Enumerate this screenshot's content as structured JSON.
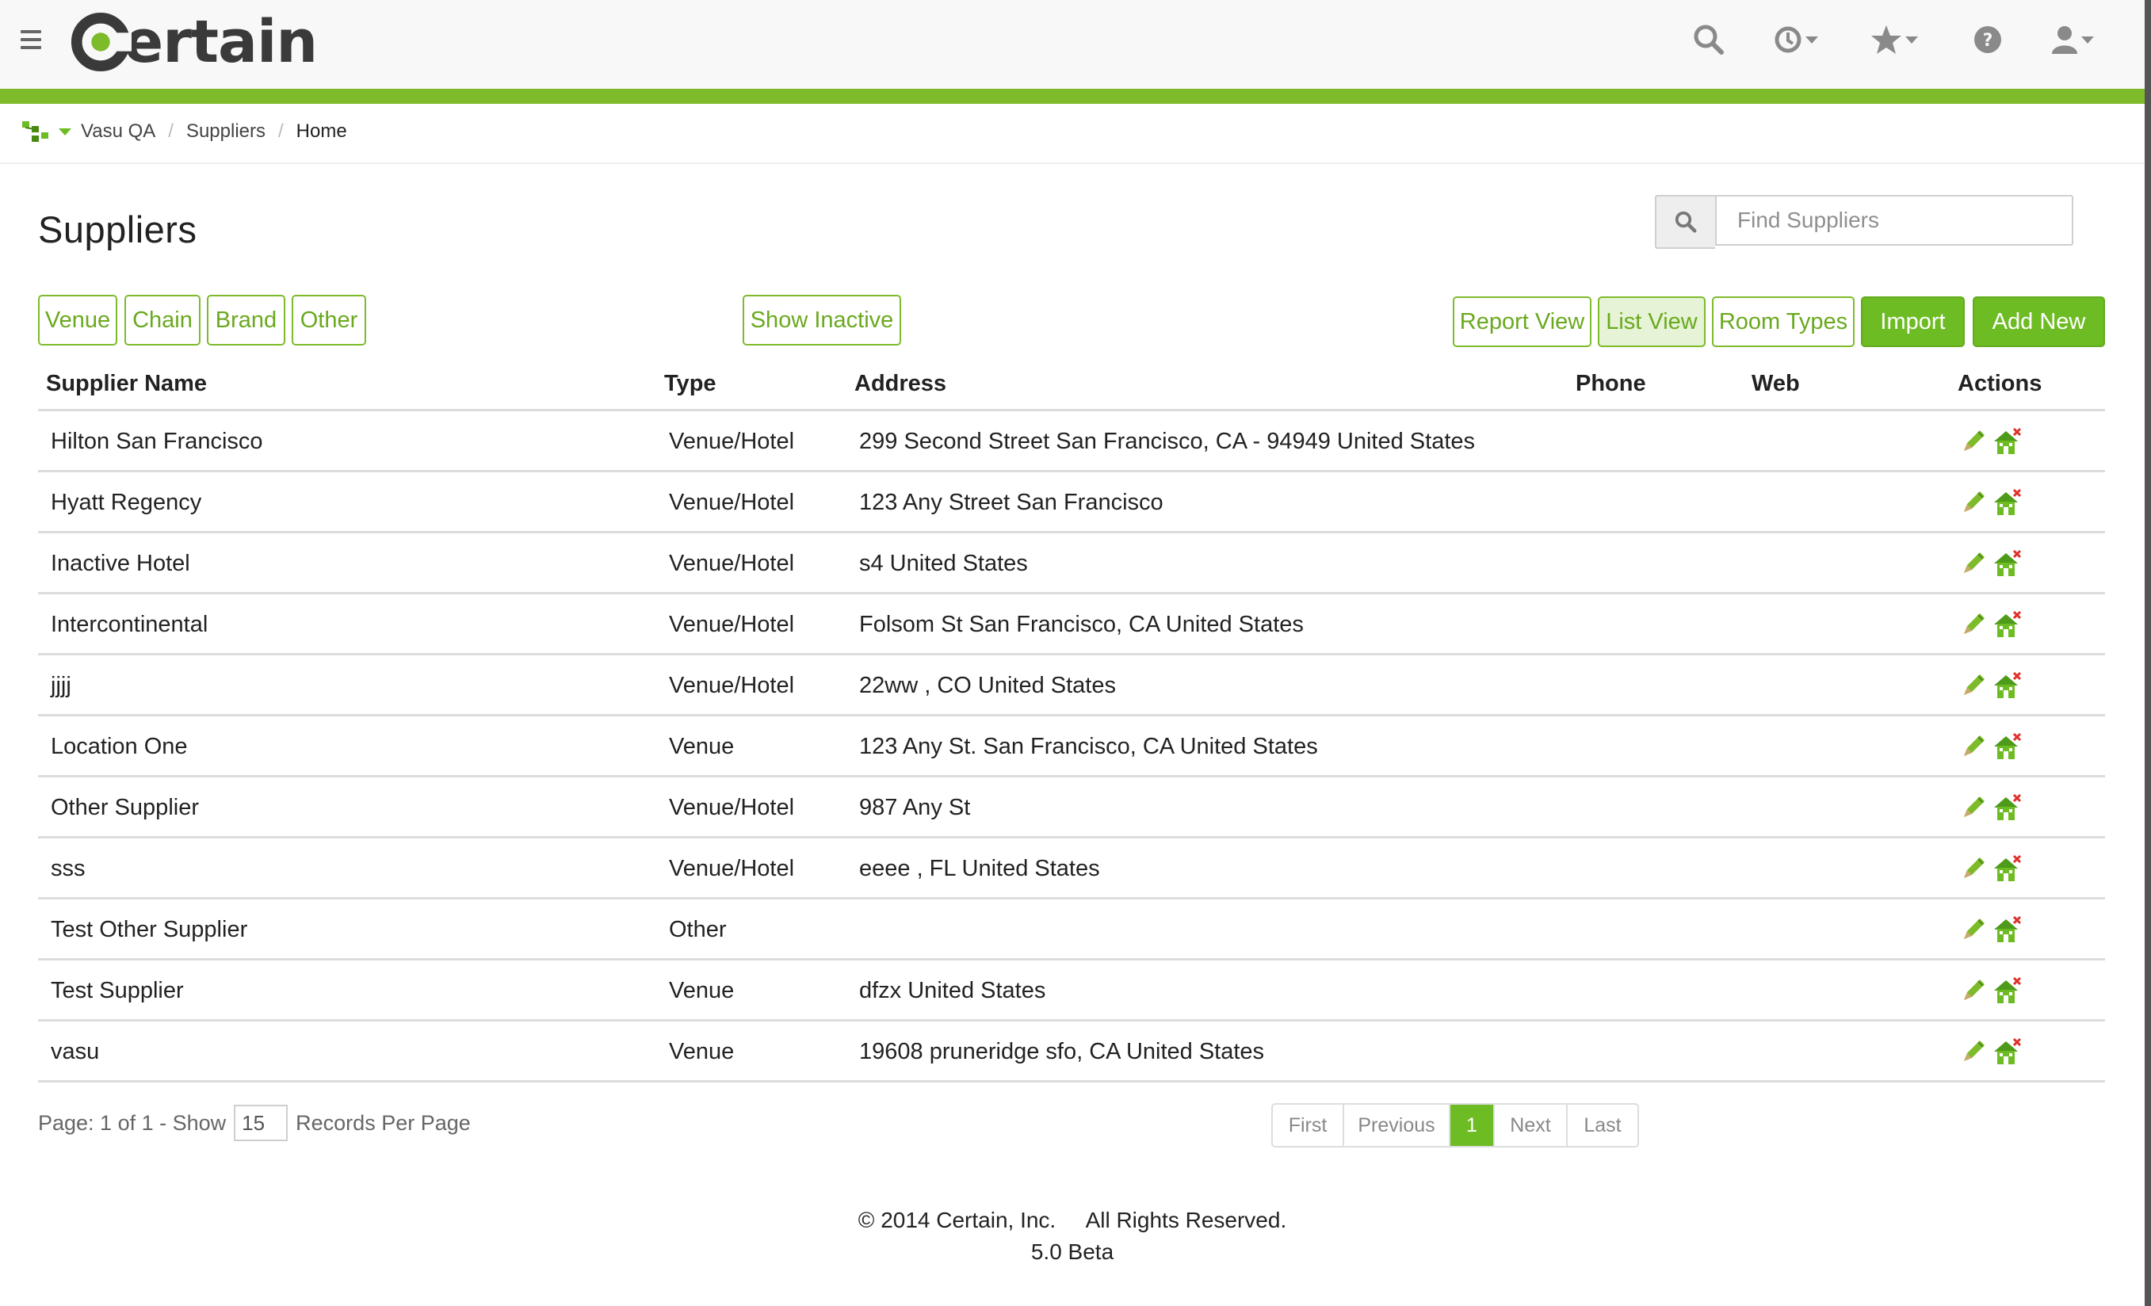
{
  "app": {
    "logo_text": "ertain"
  },
  "breadcrumb": {
    "items": [
      "Vasu QA",
      "Suppliers",
      "Home"
    ]
  },
  "page": {
    "title": "Suppliers"
  },
  "search": {
    "placeholder": "Find Suppliers",
    "value": ""
  },
  "filters": {
    "venue": "Venue",
    "chain": "Chain",
    "brand": "Brand",
    "other": "Other",
    "show_inactive": "Show Inactive"
  },
  "toolbar": {
    "report_view": "Report View",
    "list_view": "List View",
    "room_types": "Room Types",
    "import": "Import",
    "add_new": "Add New"
  },
  "table": {
    "headers": {
      "name": "Supplier Name",
      "type": "Type",
      "address": "Address",
      "phone": "Phone",
      "web": "Web",
      "actions": "Actions"
    },
    "rows": [
      {
        "name": "Hilton San Francisco",
        "type": "Venue/Hotel",
        "address": "299 Second Street San Francisco, CA - 94949 United States"
      },
      {
        "name": "Hyatt Regency",
        "type": "Venue/Hotel",
        "address": "123 Any Street San Francisco"
      },
      {
        "name": "Inactive Hotel",
        "type": "Venue/Hotel",
        "address": "s4 United States"
      },
      {
        "name": "Intercontinental",
        "type": "Venue/Hotel",
        "address": "Folsom St San Francisco, CA United States"
      },
      {
        "name": "jjjj",
        "type": "Venue/Hotel",
        "address": "22ww , CO United States"
      },
      {
        "name": "Location One",
        "type": "Venue",
        "address": "123 Any St. San Francisco, CA United States"
      },
      {
        "name": "Other Supplier",
        "type": "Venue/Hotel",
        "address": "987 Any St"
      },
      {
        "name": "sss",
        "type": "Venue/Hotel",
        "address": "eeee , FL United States"
      },
      {
        "name": "Test Other Supplier",
        "type": "Other",
        "address": ""
      },
      {
        "name": "Test Supplier",
        "type": "Venue",
        "address": "dfzx United States"
      },
      {
        "name": "vasu",
        "type": "Venue",
        "address": "19608 pruneridge sfo, CA United States"
      }
    ]
  },
  "paging": {
    "info_prefix": "Page: 1 of 1 - Show",
    "per_page": "15",
    "info_suffix": "Records Per Page",
    "first": "First",
    "previous": "Previous",
    "current": "1",
    "next": "Next",
    "last": "Last"
  },
  "footer": {
    "copyright": "© 2014 Certain, Inc.     All Rights Reserved.",
    "version": "5.0 Beta"
  },
  "colors": {
    "brand_green": "#7dbb2a",
    "button_solid": "#6ebc24"
  },
  "icons": [
    "menu-icon",
    "search-icon",
    "history-icon",
    "star-icon",
    "help-icon",
    "user-icon",
    "sitemap-icon",
    "edit-icon",
    "delete-venue-icon"
  ]
}
